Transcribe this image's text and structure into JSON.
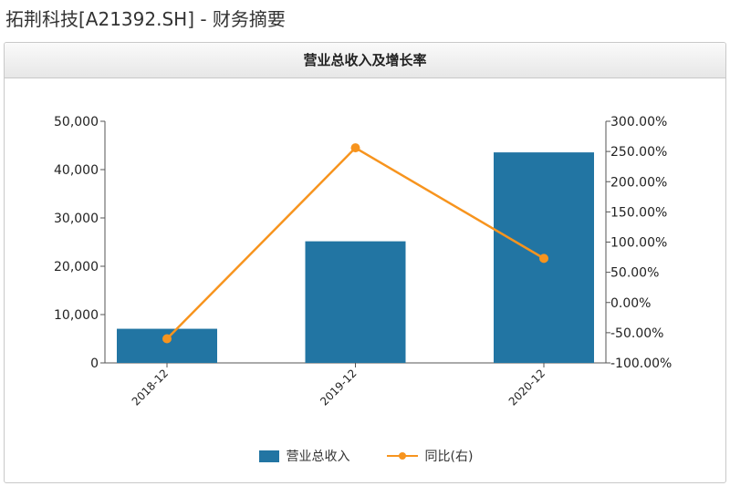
{
  "page": {
    "title": "拓荆科技[A21392.SH] - 财务摘要"
  },
  "panel": {
    "header": "营业总收入及增长率"
  },
  "colors": {
    "bar": "#2275a3",
    "line": "#f7941e",
    "axis": "#555555"
  },
  "chart_data": {
    "type": "bar",
    "title": "营业总收入及增长率",
    "categories": [
      "2018-12",
      "2019-12",
      "2020-12"
    ],
    "series": [
      {
        "name": "营业总收入",
        "type": "bar",
        "axis": "left",
        "values": [
          7064,
          25164,
          43563
        ]
      },
      {
        "name": "同比(右)",
        "type": "line",
        "axis": "right",
        "values": [
          -60,
          256,
          73
        ]
      }
    ],
    "y_left": {
      "min": 0,
      "max": 50000,
      "ticks": [
        0,
        10000,
        20000,
        30000,
        40000,
        50000
      ],
      "tick_labels": [
        "0",
        "10,000",
        "20,000",
        "30,000",
        "40,000",
        "50,000"
      ]
    },
    "y_right": {
      "min": -100,
      "max": 300,
      "ticks": [
        -100,
        -50,
        0,
        50,
        100,
        150,
        200,
        250,
        300
      ],
      "tick_labels": [
        "-100.00%",
        "-50.00%",
        "0.00%",
        "50.00%",
        "100.00%",
        "150.00%",
        "200.00%",
        "250.00%",
        "300.00%"
      ]
    },
    "grid": false,
    "legend": "bottom"
  }
}
